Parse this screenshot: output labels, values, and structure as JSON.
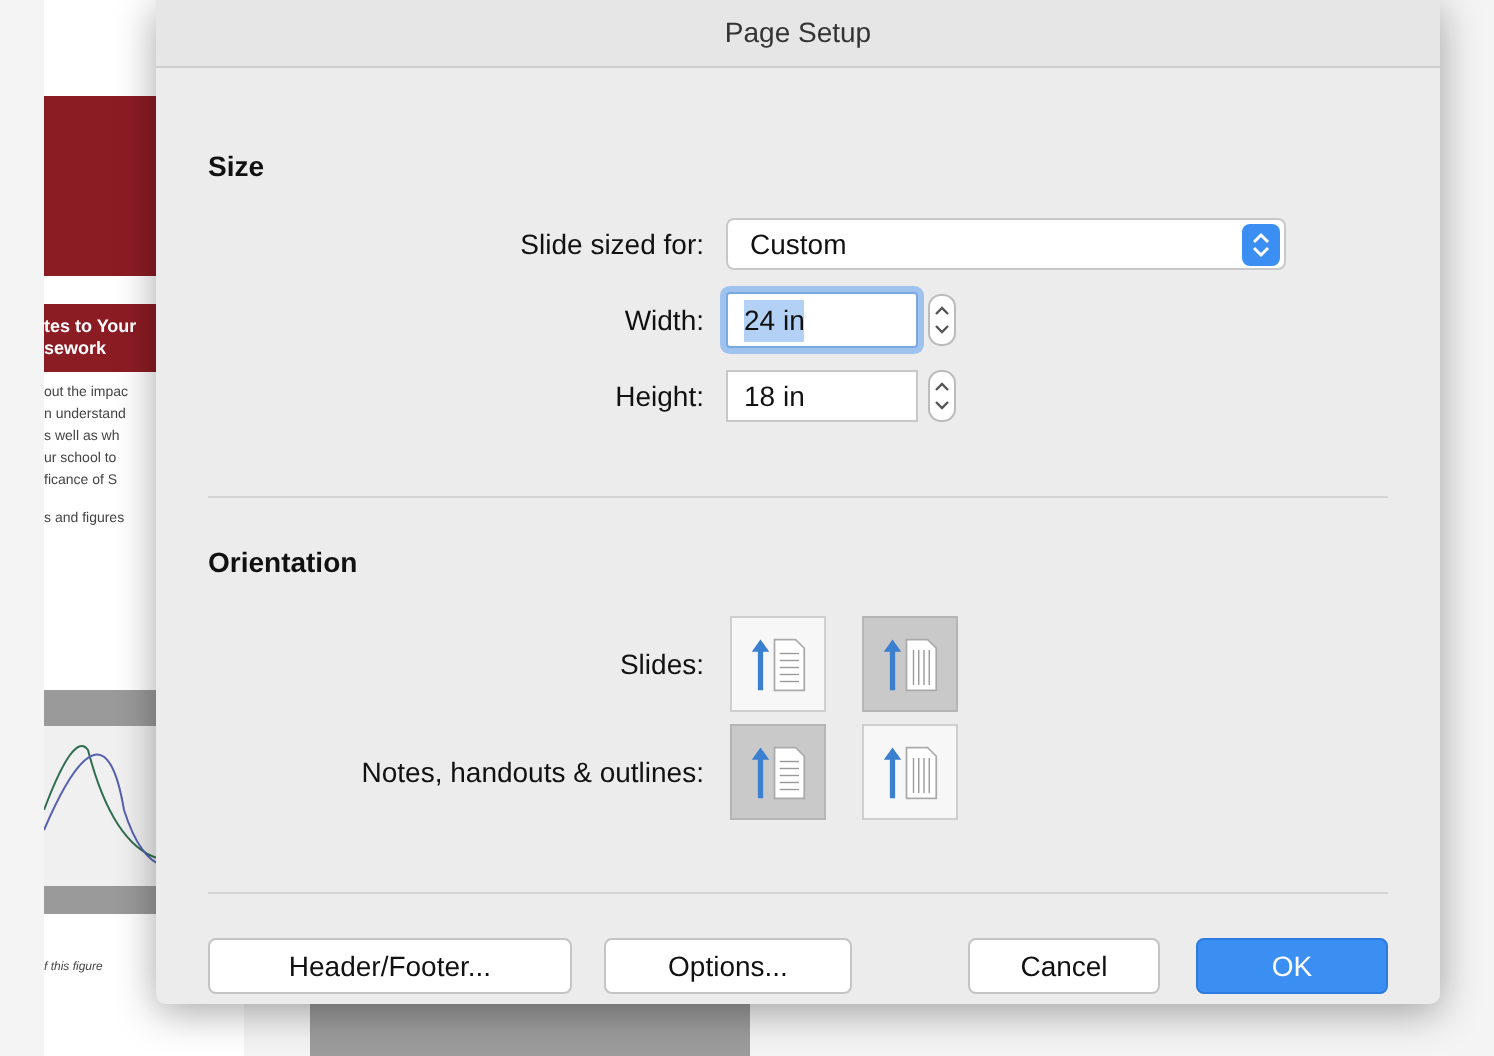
{
  "background_document": {
    "heading_lines": [
      "tes to Your",
      "sework"
    ],
    "body_lines": [
      "out the impac",
      "n understand",
      "s well as wh",
      "ur school to",
      "ficance of S"
    ],
    "note": "s and figures",
    "figure_caption": "f this figure"
  },
  "dialog": {
    "title": "Page Setup",
    "size": {
      "heading": "Size",
      "fields": [
        {
          "kind": "select",
          "label": "Slide sized for:",
          "value": "Custom"
        },
        {
          "kind": "stepper",
          "label": "Width:",
          "value": "24 in",
          "focused": true
        },
        {
          "kind": "stepper",
          "label": "Height:",
          "value": "18 in",
          "focused": false
        }
      ]
    },
    "orientation": {
      "heading": "Orientation",
      "rows": [
        {
          "label": "Slides:",
          "options": [
            {
              "kind": "portrait",
              "selected": false
            },
            {
              "kind": "landscape",
              "selected": true
            }
          ]
        },
        {
          "label": "Notes, handouts & outlines:",
          "options": [
            {
              "kind": "portrait",
              "selected": true
            },
            {
              "kind": "landscape",
              "selected": false
            }
          ]
        }
      ]
    },
    "buttons": [
      {
        "label": "Header/Footer...",
        "default": false
      },
      {
        "label": "Options...",
        "default": false
      },
      {
        "label": "Cancel",
        "default": false
      },
      {
        "label": "OK",
        "default": true
      }
    ]
  }
}
